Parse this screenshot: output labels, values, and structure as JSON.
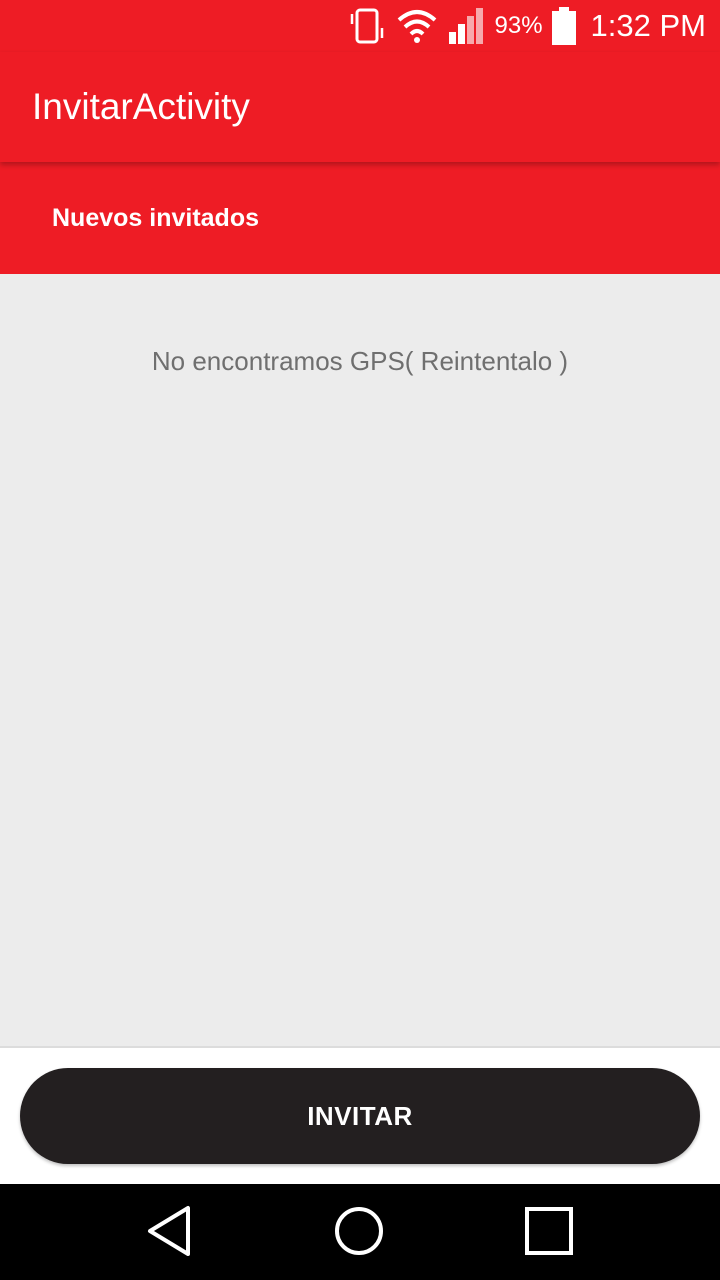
{
  "status_bar": {
    "battery_percent": "93%",
    "time": "1:32 PM",
    "icons": [
      "vibrate-icon",
      "wifi-icon",
      "signal-icon",
      "battery-icon"
    ]
  },
  "app_bar": {
    "title": "InvitarActivity"
  },
  "section": {
    "title": "Nuevos invitados"
  },
  "content": {
    "empty_message": "No encontramos GPS( Reintentalo )"
  },
  "actions": {
    "invite_label": "INVITAR"
  },
  "nav_bar": {
    "icons": [
      "back-icon",
      "home-icon",
      "recents-icon"
    ]
  },
  "colors": {
    "primary": "#ee1c25",
    "button": "#231f20",
    "background": "#ececec"
  }
}
